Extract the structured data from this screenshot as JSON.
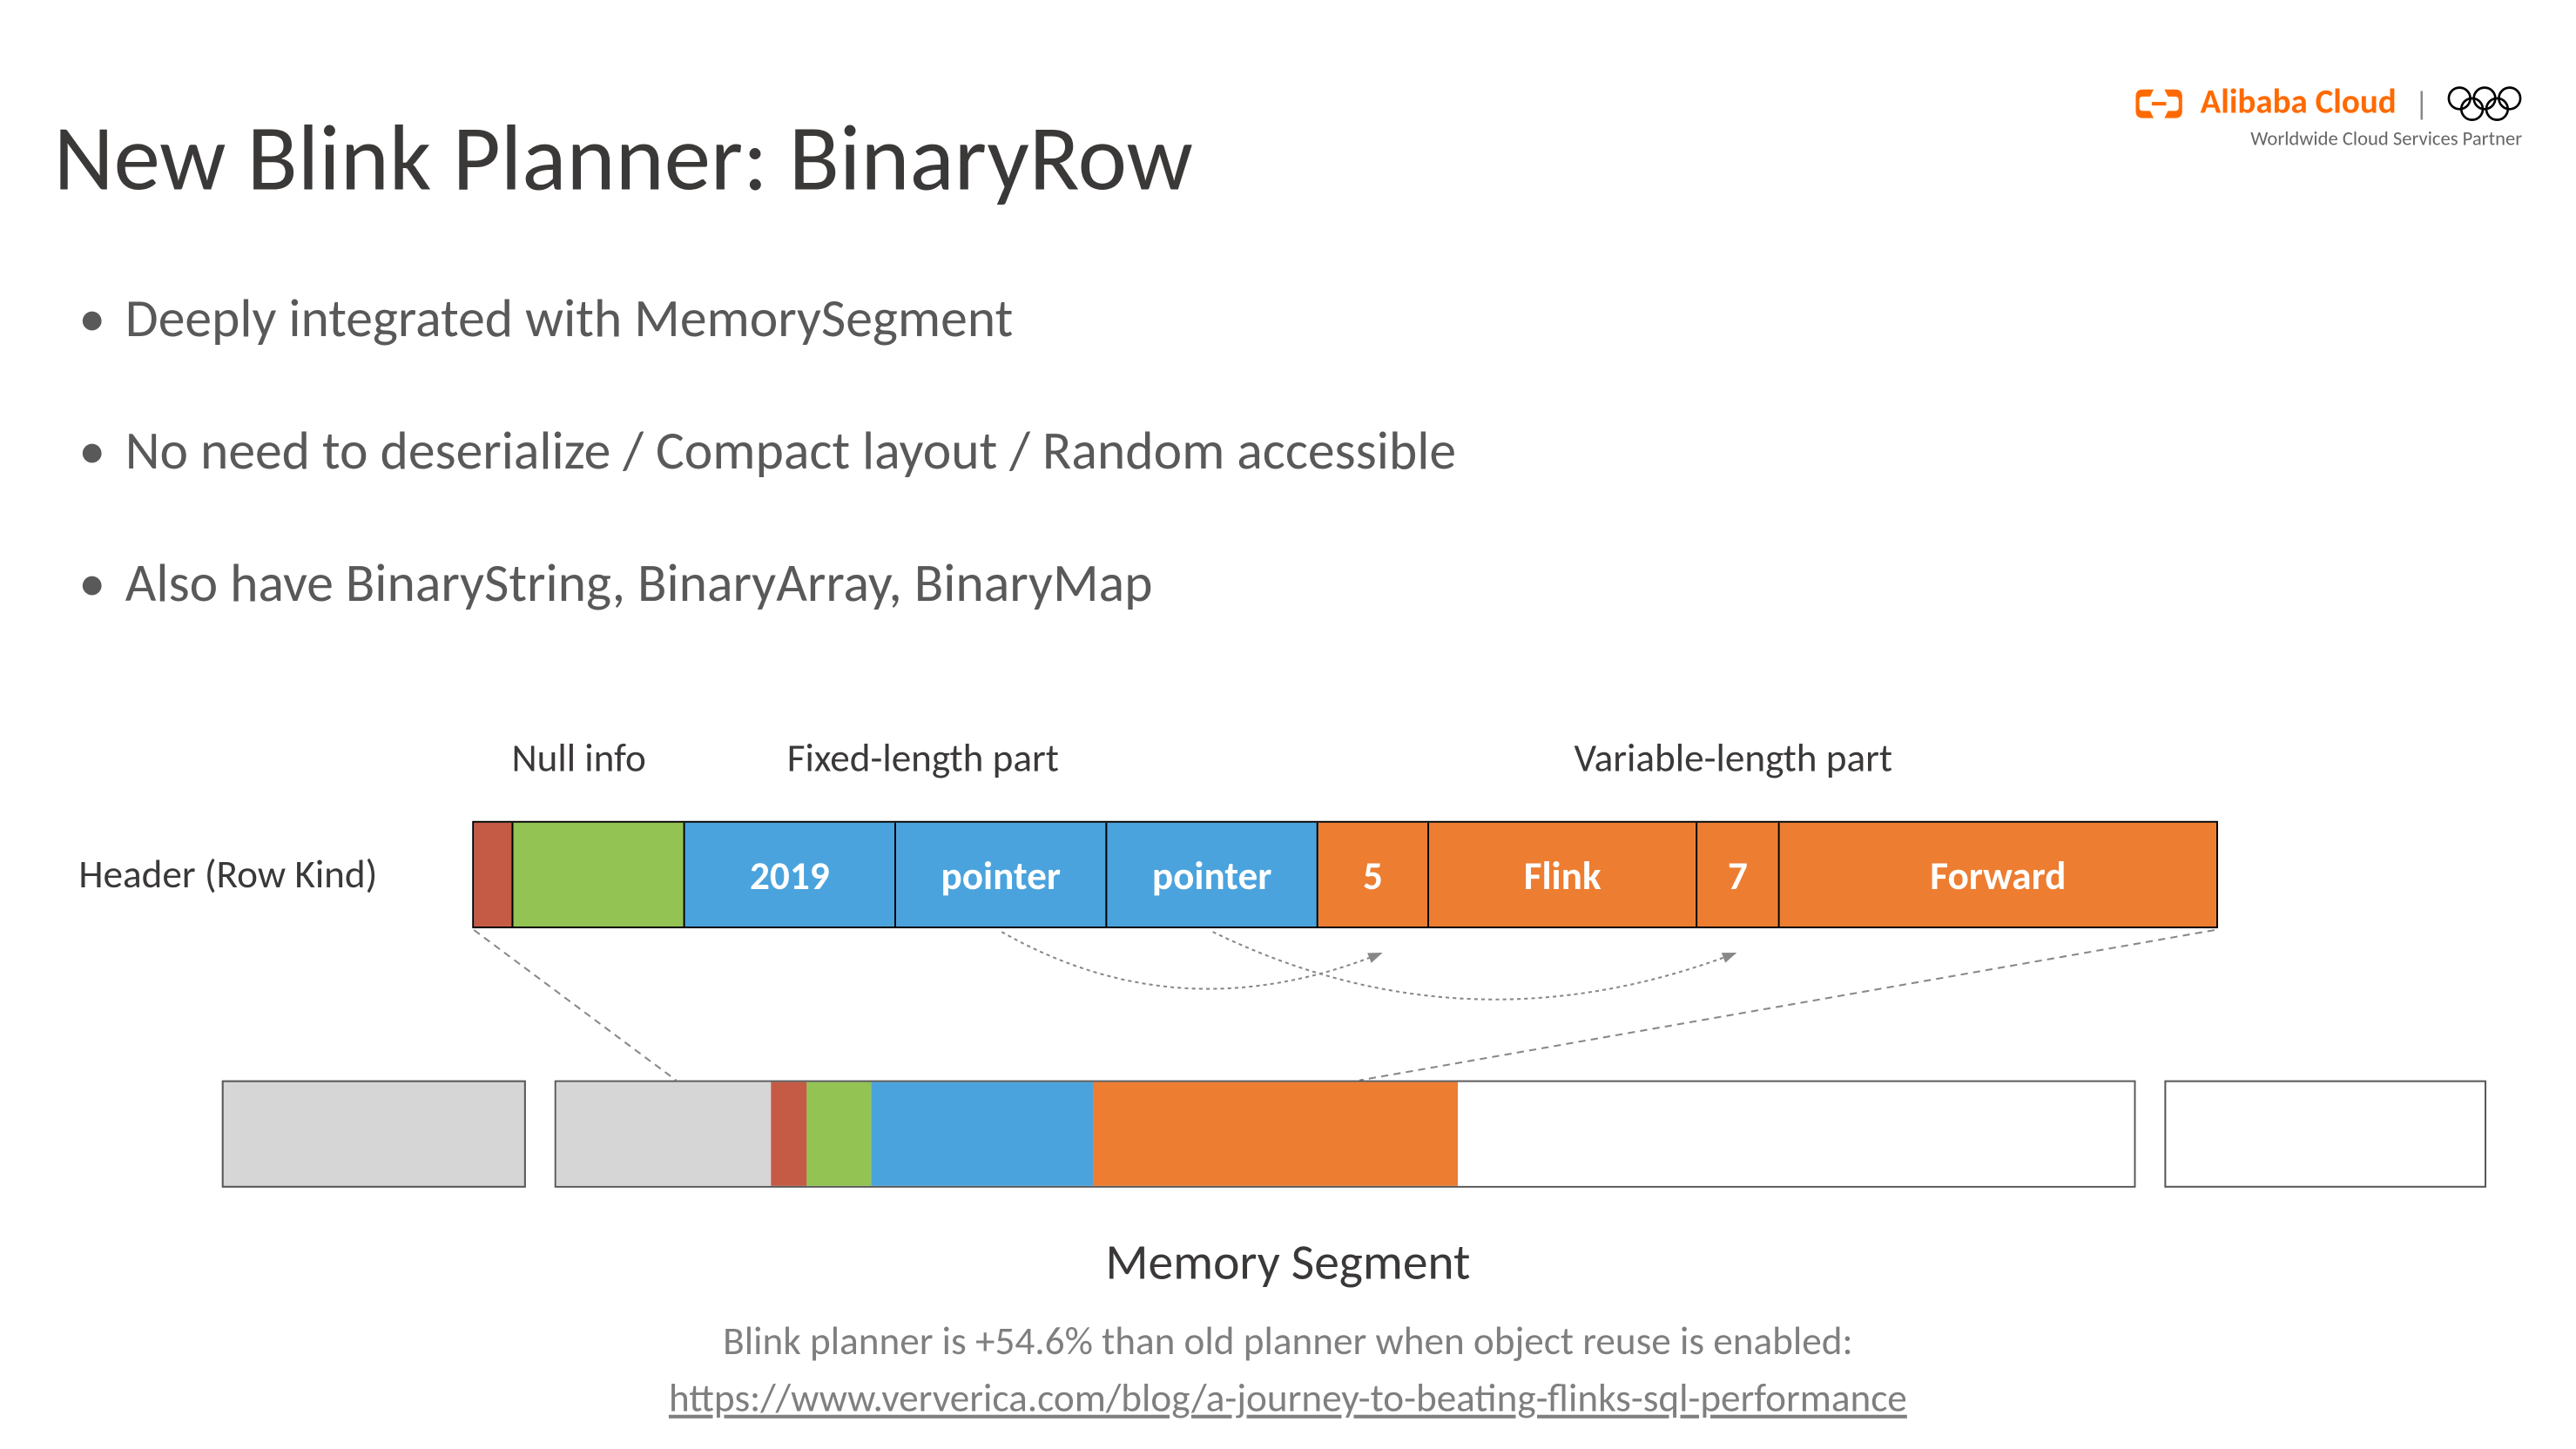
{
  "brand": {
    "name": "Alibaba Cloud",
    "subtitle": "Worldwide Cloud Services Partner"
  },
  "title": "New Blink Planner: BinaryRow",
  "bullets": [
    "Deeply integrated with MemorySegment",
    "No need to deserialize / Compact layout / Random accessible",
    "Also have BinaryString, BinaryArray, BinaryMap"
  ],
  "diagram": {
    "labels": {
      "header": "Header (Row Kind)",
      "null_info": "Null info",
      "fixed": "Fixed-length part",
      "variable": "Variable-length part",
      "memory_segment": "Memory Segment"
    },
    "cells": {
      "year": "2019",
      "ptr1": "pointer",
      "ptr2": "pointer",
      "len1": "5",
      "str1": "Flink",
      "len2": "7",
      "str2": "Forward"
    }
  },
  "footer": {
    "text": "Blink planner is +54.6% than old planner when object reuse is enabled:",
    "link": "https://www.ververica.com/blog/a-journey-to-beating-flinks-sql-performance"
  }
}
